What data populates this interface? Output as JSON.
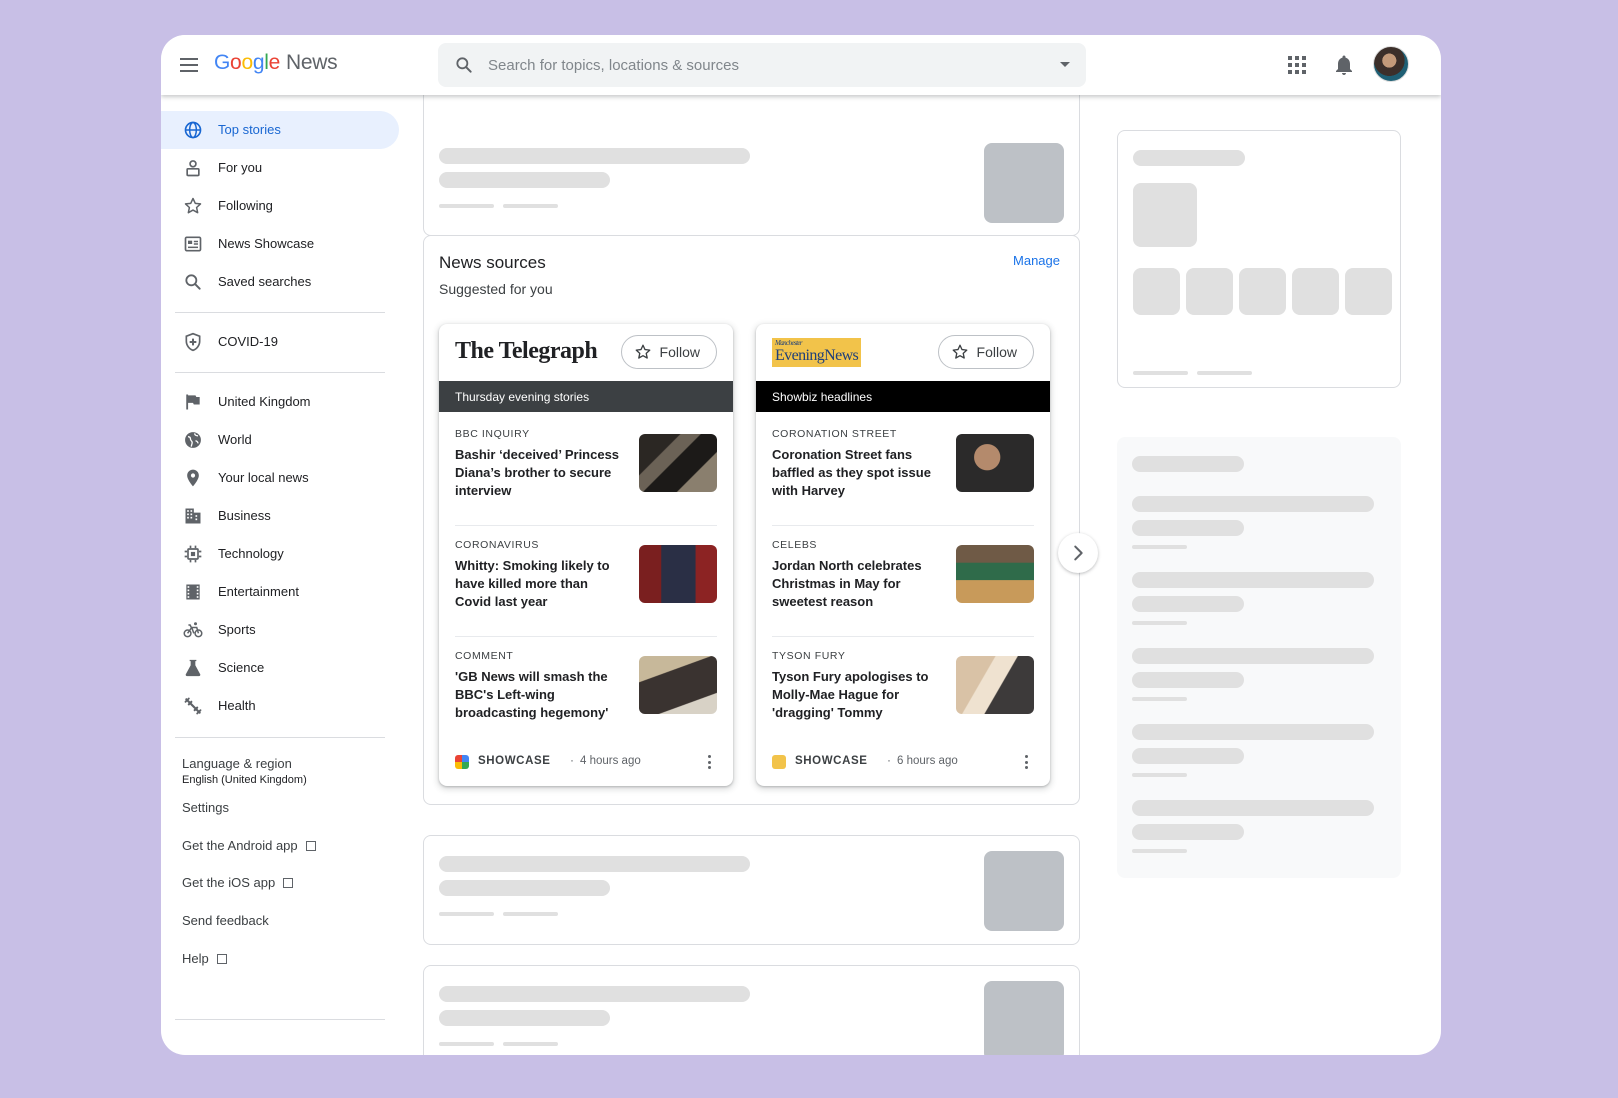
{
  "header": {
    "logo": {
      "letters": [
        "G",
        "o",
        "o",
        "g",
        "l",
        "e"
      ],
      "suffix": "News"
    },
    "search": {
      "placeholder": "Search for topics, locations & sources"
    },
    "icons": [
      "menu-icon",
      "search-icon",
      "dropdown-icon",
      "apps-icon",
      "notifications-icon",
      "account-avatar"
    ]
  },
  "sidebar": {
    "items": [
      {
        "label": "Top stories",
        "icon": "globe-icon",
        "active": true
      },
      {
        "label": "For you",
        "icon": "person-icon"
      },
      {
        "label": "Following",
        "icon": "star-icon"
      },
      {
        "label": "News Showcase",
        "icon": "showcase-icon"
      },
      {
        "label": "Saved searches",
        "icon": "search-icon"
      },
      {
        "label": "COVID-19",
        "icon": "shield-icon"
      },
      {
        "label": "United Kingdom",
        "icon": "flag-icon"
      },
      {
        "label": "World",
        "icon": "world-icon"
      },
      {
        "label": "Your local news",
        "icon": "location-pin-icon"
      },
      {
        "label": "Business",
        "icon": "building-icon"
      },
      {
        "label": "Technology",
        "icon": "chip-icon"
      },
      {
        "label": "Entertainment",
        "icon": "film-icon"
      },
      {
        "label": "Sports",
        "icon": "bicycle-icon"
      },
      {
        "label": "Science",
        "icon": "flask-icon"
      },
      {
        "label": "Health",
        "icon": "fitness-icon"
      }
    ],
    "footer": {
      "language_label": "Language & region",
      "language_value": "English (United Kingdom)",
      "settings": "Settings",
      "android": "Get the Android app",
      "ios": "Get the iOS app",
      "feedback": "Send feedback",
      "help": "Help"
    }
  },
  "news_sources": {
    "title": "News sources",
    "subtitle": "Suggested for you",
    "manage": "Manage",
    "sources": [
      {
        "name": "The Telegraph",
        "follow": "Follow",
        "band": "Thursday evening stories",
        "band_color": "#3c4043",
        "stories": [
          {
            "category": "BBC INQUIRY",
            "headline": "Bashir ‘deceived’ Princess Diana’s brother to secure interview"
          },
          {
            "category": "CORONAVIRUS",
            "headline": "Whitty: Smoking likely to have killed more than Covid last year"
          },
          {
            "category": "COMMENT",
            "headline": "'GB News will smash the BBC's Left-wing broadcasting hegemony'"
          }
        ],
        "footer": {
          "label": "SHOWCASE",
          "separator": "·",
          "time": "4 hours ago"
        }
      },
      {
        "name": "Manchester Evening News",
        "logo_small": "Manchester",
        "logo_main": "EveningNews",
        "follow": "Follow",
        "band": "Showbiz headlines",
        "band_color": "#000000",
        "stories": [
          {
            "category": "CORONATION STREET",
            "headline": "Coronation Street fans baffled as they spot issue with Harvey"
          },
          {
            "category": "CELEBS",
            "headline": "Jordan North celebrates Christmas in May for sweetest reason"
          },
          {
            "category": "TYSON FURY",
            "headline": "Tyson Fury apologises to Molly-Mae Hague for 'dragging' Tommy"
          }
        ],
        "footer": {
          "label": "SHOWCASE",
          "separator": "·",
          "time": "6 hours ago"
        }
      }
    ]
  },
  "colors": {
    "accent": "#1a73e8",
    "active_bg": "#e8f0fe",
    "background": "#c8bfe6",
    "skeleton": "#e0e0e0"
  }
}
